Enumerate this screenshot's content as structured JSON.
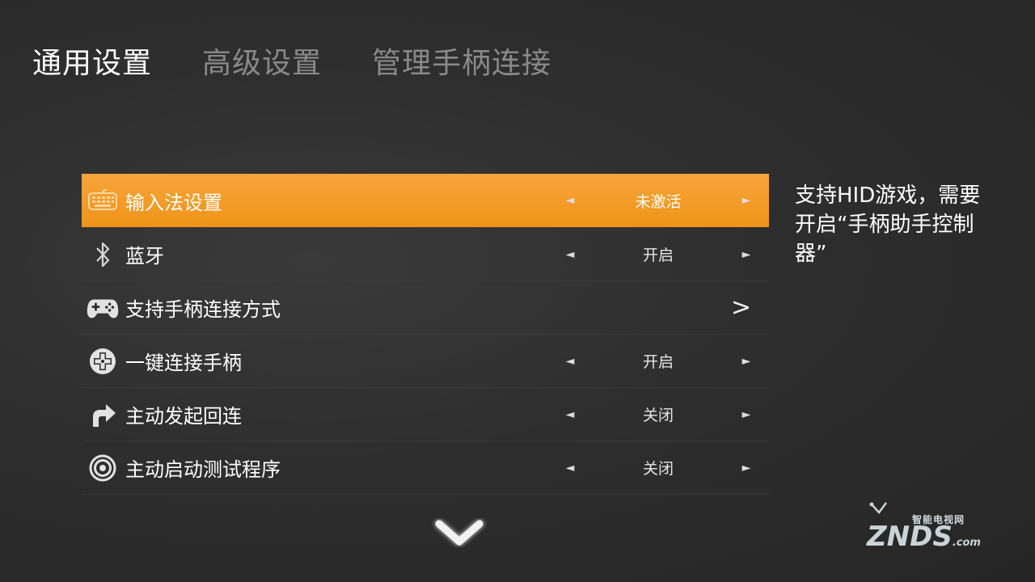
{
  "tabs": [
    {
      "label": "通用设置",
      "active": true
    },
    {
      "label": "高级设置",
      "active": false
    },
    {
      "label": "管理手柄连接",
      "active": false
    }
  ],
  "menu": {
    "items": [
      {
        "label": "输入法设置",
        "value": "未激活",
        "icon": "keyboard-icon",
        "selected": true
      },
      {
        "label": "蓝牙",
        "value": "开启",
        "icon": "bluetooth-icon"
      },
      {
        "label": "支持手柄连接方式",
        "value": "",
        "icon": "gamepad-icon",
        "chevron": ">"
      },
      {
        "label": "一键连接手柄",
        "value": "开启",
        "icon": "dpad-icon"
      },
      {
        "label": "主动发起回连",
        "value": "关闭",
        "icon": "reconnect-arrow-icon"
      },
      {
        "label": "主动启动测试程序",
        "value": "关闭",
        "icon": "target-icon"
      }
    ],
    "arrow_left": "◄",
    "arrow_right": "►"
  },
  "description": "支持HID游戏，需要开启“手柄助手控制器”",
  "watermark": {
    "sub": "智能电视网",
    "main": "ZNDS",
    "suffix": ".com"
  },
  "colors": {
    "accent": "#f29a22",
    "background": "#2e2e2e",
    "inactive_tab": "#8a8a8a"
  }
}
